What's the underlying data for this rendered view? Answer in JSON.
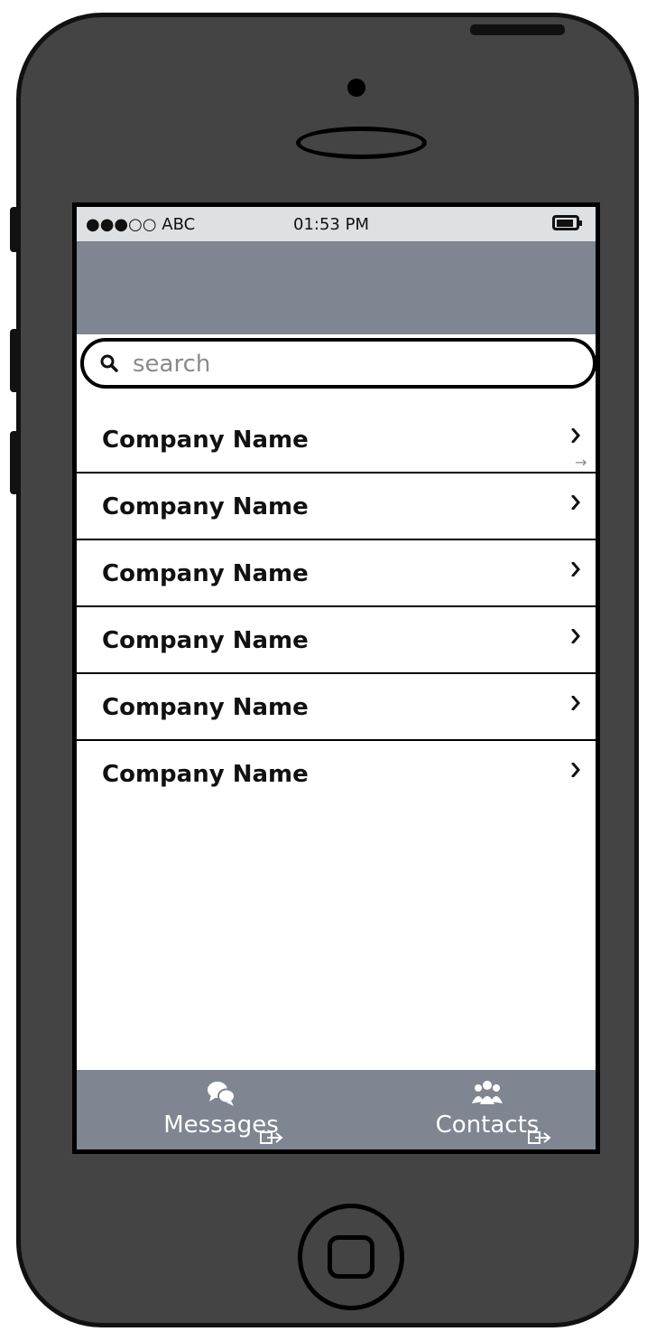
{
  "status_bar": {
    "carrier": "●●●○○ ABC",
    "time": "01:53 PM"
  },
  "search": {
    "placeholder": "search"
  },
  "companies": [
    {
      "name": "Company Name"
    },
    {
      "name": "Company Name"
    },
    {
      "name": "Company Name"
    },
    {
      "name": "Company Name"
    },
    {
      "name": "Company Name"
    },
    {
      "name": "Company Name"
    }
  ],
  "tabs": [
    {
      "label": "Messages",
      "icon": "chat-bubbles-icon"
    },
    {
      "label": "Contacts",
      "icon": "group-icon"
    }
  ],
  "colors": {
    "device": "#444444",
    "status_bar": "#dde1e3",
    "nav_bar": "#7f8591",
    "tab_bar": "#7f8591"
  }
}
